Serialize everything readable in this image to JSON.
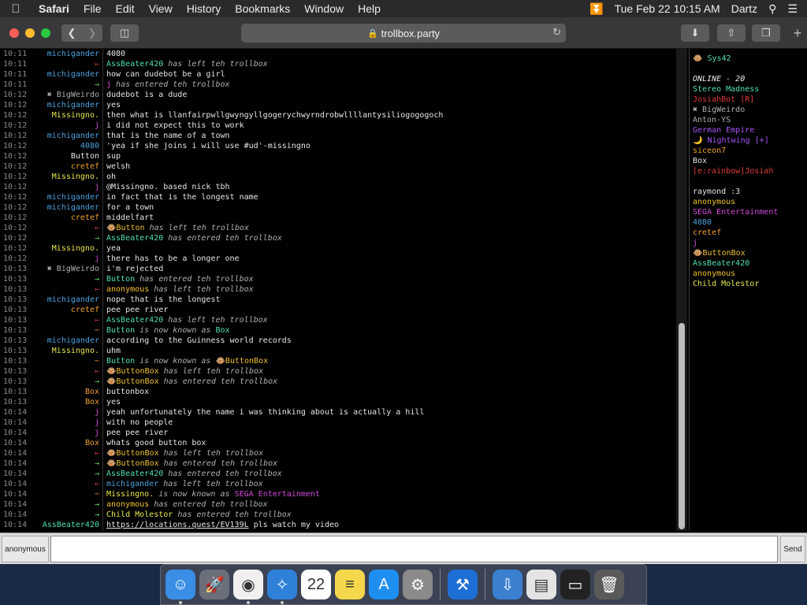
{
  "menubar": {
    "apple_icon": "apple-icon",
    "menus": [
      "Safari",
      "File",
      "Edit",
      "View",
      "History",
      "Bookmarks",
      "Window",
      "Help"
    ],
    "datetime": "Tue Feb 22  10:15 AM",
    "user": "Dartz"
  },
  "toolbar": {
    "url": "trollbox.party"
  },
  "colors": {
    "blue": "#4aa3df",
    "red": "#e33b3b",
    "green": "#4fe06a",
    "yellow": "#e6e84a",
    "orange": "#f0a030",
    "magenta": "#d24ad8",
    "purple": "#a855f7",
    "teal": "#4fe0b0",
    "white": "#e6e6e6",
    "gray": "#b0b0b0",
    "goldyellow": "#f2c230",
    "pink": "#ff3b6b"
  },
  "messages": [
    {
      "time": "10:11",
      "nick": "michigander",
      "nick_color": "#4aa3df",
      "parts": [
        {
          "t": "4080"
        }
      ]
    },
    {
      "time": "10:11",
      "nick": "←",
      "nick_color": "#e33b3b",
      "parts": [
        {
          "t": "AssBeater420",
          "c": "#4fe0b0"
        },
        {
          "t": " has left teh trollbox",
          "em": true
        }
      ]
    },
    {
      "time": "10:11",
      "nick": "michigander",
      "nick_color": "#4aa3df",
      "parts": [
        {
          "t": "how can dudebot be a girl"
        }
      ]
    },
    {
      "time": "10:11",
      "nick": "→",
      "nick_color": "#4fe06a",
      "parts": [
        {
          "t": "j",
          "c": "#d24ad8"
        },
        {
          "t": " has entered teh trollbox",
          "em": true
        }
      ]
    },
    {
      "time": "10:12",
      "nick": "✖ BigWeirdo",
      "nick_color": "#b0b0b0",
      "parts": [
        {
          "t": "dudebot is a dude"
        }
      ]
    },
    {
      "time": "10:12",
      "nick": "michigander",
      "nick_color": "#4aa3df",
      "parts": [
        {
          "t": "yes"
        }
      ]
    },
    {
      "time": "10:12",
      "nick": "Missingno.",
      "nick_color": "#e6e84a",
      "parts": [
        {
          "t": "then what is llanfairpwllgwyngyllgogerychwyrndrobwllllantysiliogogogoch"
        }
      ]
    },
    {
      "time": "10:12",
      "nick": "j",
      "nick_color": "#d24ad8",
      "parts": [
        {
          "t": "i did not expect this to work"
        }
      ]
    },
    {
      "time": "10:12",
      "nick": "michigander",
      "nick_color": "#4aa3df",
      "parts": [
        {
          "t": "that is the name of a town"
        }
      ]
    },
    {
      "time": "10:12",
      "nick": "4080",
      "nick_color": "#4aa3df",
      "parts": [
        {
          "t": "'yea if she joins i will use #ud'-missingno"
        }
      ]
    },
    {
      "time": "10:12",
      "nick": "Button",
      "nick_color": "#e6e6e6",
      "parts": [
        {
          "t": "sup"
        }
      ]
    },
    {
      "time": "10:12",
      "nick": "cretef",
      "nick_color": "#f0a030",
      "parts": [
        {
          "t": "welsh"
        }
      ]
    },
    {
      "time": "10:12",
      "nick": "Missingno.",
      "nick_color": "#e6e84a",
      "parts": [
        {
          "t": "oh"
        }
      ]
    },
    {
      "time": "10:12",
      "nick": "j",
      "nick_color": "#d24ad8",
      "parts": [
        {
          "t": "@Missingno. based nick tbh"
        }
      ]
    },
    {
      "time": "10:12",
      "nick": "michigander",
      "nick_color": "#4aa3df",
      "parts": [
        {
          "t": "in fact that is the longest name"
        }
      ]
    },
    {
      "time": "10:12",
      "nick": "michigander",
      "nick_color": "#4aa3df",
      "parts": [
        {
          "t": "for a town"
        }
      ]
    },
    {
      "time": "10:12",
      "nick": "cretef",
      "nick_color": "#f0a030",
      "parts": [
        {
          "t": "middelfart"
        }
      ]
    },
    {
      "time": "10:12",
      "nick": "←",
      "nick_color": "#e33b3b",
      "parts": [
        {
          "t": "🐵Button",
          "c": "#f2c230"
        },
        {
          "t": " has left teh trollbox",
          "em": true
        }
      ]
    },
    {
      "time": "10:12",
      "nick": "→",
      "nick_color": "#4fe06a",
      "parts": [
        {
          "t": "AssBeater420",
          "c": "#4fe0b0"
        },
        {
          "t": " has entered teh trollbox",
          "em": true
        }
      ]
    },
    {
      "time": "10:12",
      "nick": "Missingno.",
      "nick_color": "#e6e84a",
      "parts": [
        {
          "t": "yea"
        }
      ]
    },
    {
      "time": "10:12",
      "nick": "j",
      "nick_color": "#d24ad8",
      "parts": [
        {
          "t": "there has to be a longer one"
        }
      ]
    },
    {
      "time": "10:13",
      "nick": "✖ BigWeirdo",
      "nick_color": "#b0b0b0",
      "parts": [
        {
          "t": "i'm rejected"
        }
      ]
    },
    {
      "time": "10:13",
      "nick": "→",
      "nick_color": "#4fe06a",
      "parts": [
        {
          "t": "Button",
          "c": "#4fe0b0"
        },
        {
          "t": " has entered teh trollbox",
          "em": true
        }
      ]
    },
    {
      "time": "10:13",
      "nick": "←",
      "nick_color": "#e33b3b",
      "parts": [
        {
          "t": "anonymous",
          "c": "#f2c230"
        },
        {
          "t": " has left teh trollbox",
          "em": true
        }
      ]
    },
    {
      "time": "10:13",
      "nick": "michigander",
      "nick_color": "#4aa3df",
      "parts": [
        {
          "t": "nope that is the longest"
        }
      ]
    },
    {
      "time": "10:13",
      "nick": "cretef",
      "nick_color": "#f0a030",
      "parts": [
        {
          "t": "pee pee river"
        }
      ]
    },
    {
      "time": "10:13",
      "nick": "←",
      "nick_color": "#e33b3b",
      "parts": [
        {
          "t": "AssBeater420",
          "c": "#4fe0b0"
        },
        {
          "t": " has left teh trollbox",
          "em": true
        }
      ]
    },
    {
      "time": "10:13",
      "nick": "~",
      "nick_color": "#f0a030",
      "parts": [
        {
          "t": "Button",
          "c": "#4fe0b0"
        },
        {
          "t": " is now known as ",
          "em": true
        },
        {
          "t": "Box",
          "c": "#4fe0b0"
        }
      ]
    },
    {
      "time": "10:13",
      "nick": "michigander",
      "nick_color": "#4aa3df",
      "parts": [
        {
          "t": "according to the Guinness world records"
        }
      ]
    },
    {
      "time": "10:13",
      "nick": "Missingno.",
      "nick_color": "#e6e84a",
      "parts": [
        {
          "t": "uhm"
        }
      ]
    },
    {
      "time": "10:13",
      "nick": "~",
      "nick_color": "#f0a030",
      "parts": [
        {
          "t": "Button",
          "c": "#4fe0b0"
        },
        {
          "t": " is now known as ",
          "em": true
        },
        {
          "t": "🐵ButtonBox",
          "c": "#f2c230"
        }
      ]
    },
    {
      "time": "10:13",
      "nick": "←",
      "nick_color": "#e33b3b",
      "parts": [
        {
          "t": "🐵ButtonBox",
          "c": "#f2c230"
        },
        {
          "t": " has left teh trollbox",
          "em": true
        }
      ]
    },
    {
      "time": "10:13",
      "nick": "→",
      "nick_color": "#4fe06a",
      "parts": [
        {
          "t": "🐵ButtonBox",
          "c": "#f2c230"
        },
        {
          "t": " has entered teh trollbox",
          "em": true
        }
      ]
    },
    {
      "time": "10:13",
      "nick": "Box",
      "nick_color": "#f0a030",
      "parts": [
        {
          "t": "buttonbox"
        }
      ]
    },
    {
      "time": "10:13",
      "nick": "Box",
      "nick_color": "#f0a030",
      "parts": [
        {
          "t": "yes"
        }
      ]
    },
    {
      "time": "10:14",
      "nick": "j",
      "nick_color": "#d24ad8",
      "parts": [
        {
          "t": "yeah unfortunately the name i was thinking about is actually a hill"
        }
      ]
    },
    {
      "time": "10:14",
      "nick": "j",
      "nick_color": "#d24ad8",
      "parts": [
        {
          "t": "with no people"
        }
      ]
    },
    {
      "time": "10:14",
      "nick": "j",
      "nick_color": "#d24ad8",
      "parts": [
        {
          "t": "pee pee river"
        }
      ]
    },
    {
      "time": "10:14",
      "nick": "Box",
      "nick_color": "#f0a030",
      "parts": [
        {
          "t": "whats good button box"
        }
      ]
    },
    {
      "time": "10:14",
      "nick": "←",
      "nick_color": "#e33b3b",
      "parts": [
        {
          "t": "🐵ButtonBox",
          "c": "#f2c230"
        },
        {
          "t": " has left teh trollbox",
          "em": true
        }
      ]
    },
    {
      "time": "10:14",
      "nick": "→",
      "nick_color": "#4fe06a",
      "parts": [
        {
          "t": "🐵ButtonBox",
          "c": "#f2c230"
        },
        {
          "t": " has entered teh trollbox",
          "em": true
        }
      ]
    },
    {
      "time": "10:14",
      "nick": "→",
      "nick_color": "#4fe06a",
      "parts": [
        {
          "t": "AssBeater420",
          "c": "#4fe0b0"
        },
        {
          "t": " has entered teh trollbox",
          "em": true
        }
      ]
    },
    {
      "time": "10:14",
      "nick": "←",
      "nick_color": "#e33b3b",
      "parts": [
        {
          "t": "michigander",
          "c": "#4aa3df"
        },
        {
          "t": " has left teh trollbox",
          "em": true
        }
      ]
    },
    {
      "time": "10:14",
      "nick": "~",
      "nick_color": "#f0a030",
      "parts": [
        {
          "t": "Missingno.",
          "c": "#e6e84a"
        },
        {
          "t": " is now known as ",
          "em": true
        },
        {
          "t": "SEGA Entertainment",
          "c": "#d24ad8"
        }
      ]
    },
    {
      "time": "10:14",
      "nick": "→",
      "nick_color": "#4fe06a",
      "parts": [
        {
          "t": "anonymous",
          "c": "#f2c230"
        },
        {
          "t": " has entered teh trollbox",
          "em": true
        }
      ]
    },
    {
      "time": "10:14",
      "nick": "→",
      "nick_color": "#4fe06a",
      "parts": [
        {
          "t": "Child Molestor",
          "c": "#e6e84a"
        },
        {
          "t": " has entered teh trollbox",
          "em": true
        }
      ]
    },
    {
      "time": "10:14",
      "nick": "AssBeater420",
      "nick_color": "#4fe0b0",
      "parts": [
        {
          "t": "https://locations.quest/EV139L",
          "link": true
        },
        {
          "t": " pls watch my video"
        }
      ]
    }
  ],
  "userlist": {
    "self": "🐵 Sys42",
    "self_color": "#4fe0b0",
    "online_header": "ONLINE - 20",
    "users": [
      {
        "name": "Stereo Madness",
        "color": "#4fe0b0"
      },
      {
        "name": "JosiahBot [R]",
        "color": "#e33b3b"
      },
      {
        "name": "✖ BigWeirdo",
        "color": "#b0b0b0"
      },
      {
        "name": "Anton-YS",
        "color": "#b0b0b0"
      },
      {
        "name": "German Empire",
        "color": "#a855f7"
      },
      {
        "name": "🌙 Nightwing [+]",
        "color": "#a855f7"
      },
      {
        "name": "siceon7",
        "color": "#f0a030"
      },
      {
        "name": "Box",
        "color": "#e6e6e6"
      },
      {
        "name": "[e:rainbow]Josiah",
        "color": "#e33b3b"
      },
      {
        "name": "⠀⠀⠀⠀",
        "color": "#a855f7"
      },
      {
        "name": "raymond :3",
        "color": "#e6e6e6"
      },
      {
        "name": "anonymous",
        "color": "#f2c230"
      },
      {
        "name": "SEGA Entertainment",
        "color": "#d24ad8"
      },
      {
        "name": "4080",
        "color": "#4aa3df"
      },
      {
        "name": "cretef",
        "color": "#f0a030"
      },
      {
        "name": "j",
        "color": "#d24ad8"
      },
      {
        "name": "🐵ButtonBox",
        "color": "#f2c230"
      },
      {
        "name": "AssBeater420",
        "color": "#4fe0b0"
      },
      {
        "name": "anonymous",
        "color": "#f2c230"
      },
      {
        "name": "Child Molestor",
        "color": "#e6e84a"
      }
    ]
  },
  "inputbar": {
    "nick": "anonymous",
    "placeholder": "",
    "value": "",
    "send_label": "Send"
  },
  "dock": {
    "items": [
      {
        "name": "finder-icon",
        "bg": "#3a8ee6",
        "glyph": "☺",
        "running": true
      },
      {
        "name": "launchpad-icon",
        "bg": "#6b6f7a",
        "glyph": "🚀",
        "running": false
      },
      {
        "name": "chrome-icon",
        "bg": "#f0f0f0",
        "glyph": "◉",
        "running": true
      },
      {
        "name": "safari-icon",
        "bg": "#2f80d8",
        "glyph": "✧",
        "running": true
      },
      {
        "name": "calendar-icon",
        "bg": "#ffffff",
        "glyph": "22",
        "running": false
      },
      {
        "name": "notes-icon",
        "bg": "#f5d74c",
        "glyph": "≡",
        "running": false
      },
      {
        "name": "app-store-icon",
        "bg": "#1f8ef1",
        "glyph": "A",
        "running": false
      },
      {
        "name": "system-preferences-icon",
        "bg": "#8a8a8a",
        "glyph": "⚙",
        "running": false
      },
      {
        "name": "xcode-icon",
        "bg": "#1d6fd6",
        "glyph": "⚒",
        "running": false
      },
      {
        "name": "downloads-stack-icon",
        "bg": "#3b7fd1",
        "glyph": "⇩",
        "running": false
      },
      {
        "name": "document-icon",
        "bg": "#e4e4e4",
        "glyph": "▤",
        "running": false
      },
      {
        "name": "minimized-window-icon",
        "bg": "#222222",
        "glyph": "▭",
        "running": false
      },
      {
        "name": "trash-icon",
        "bg": "#5a5a5a",
        "glyph": "🗑",
        "running": false
      }
    ]
  }
}
